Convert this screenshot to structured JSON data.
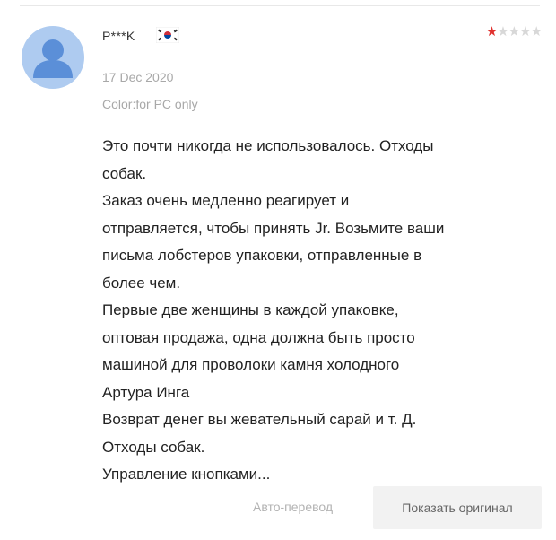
{
  "review": {
    "username": "P***K",
    "country_flag": "south-korea-flag",
    "rating": 1,
    "rating_max": 5,
    "date": "17 Dec 2020",
    "color_line": "Color:for PC only",
    "lines": [
      "Это почти никогда не использовалось. Отходы",
      "собак.",
      "Заказ очень медленно реагирует и",
      "отправляется, чтобы принять Jr. Возьмите ваши",
      "письма лобстеров упаковки, отправленные в",
      "более чем.",
      "Первые две женщины в каждой упаковке,",
      "оптовая продажа, одна должна быть просто",
      "машиной для проволоки камня холодного",
      "Артура Инга",
      "Возврат денег вы жевательный сарай и т. Д.",
      "Отходы собак.",
      "Управление кнопками..."
    ]
  },
  "actions": {
    "auto_translate": "Авто-перевод",
    "show_original": "Показать оригинал"
  },
  "colors": {
    "star_active": "#e0312e",
    "star_inactive": "#d8d8d8",
    "avatar_bg": "#aecbf0",
    "avatar_fg": "#5b8fd8",
    "meta_text": "#a8a8a8",
    "button_bg": "#f2f2f2"
  }
}
